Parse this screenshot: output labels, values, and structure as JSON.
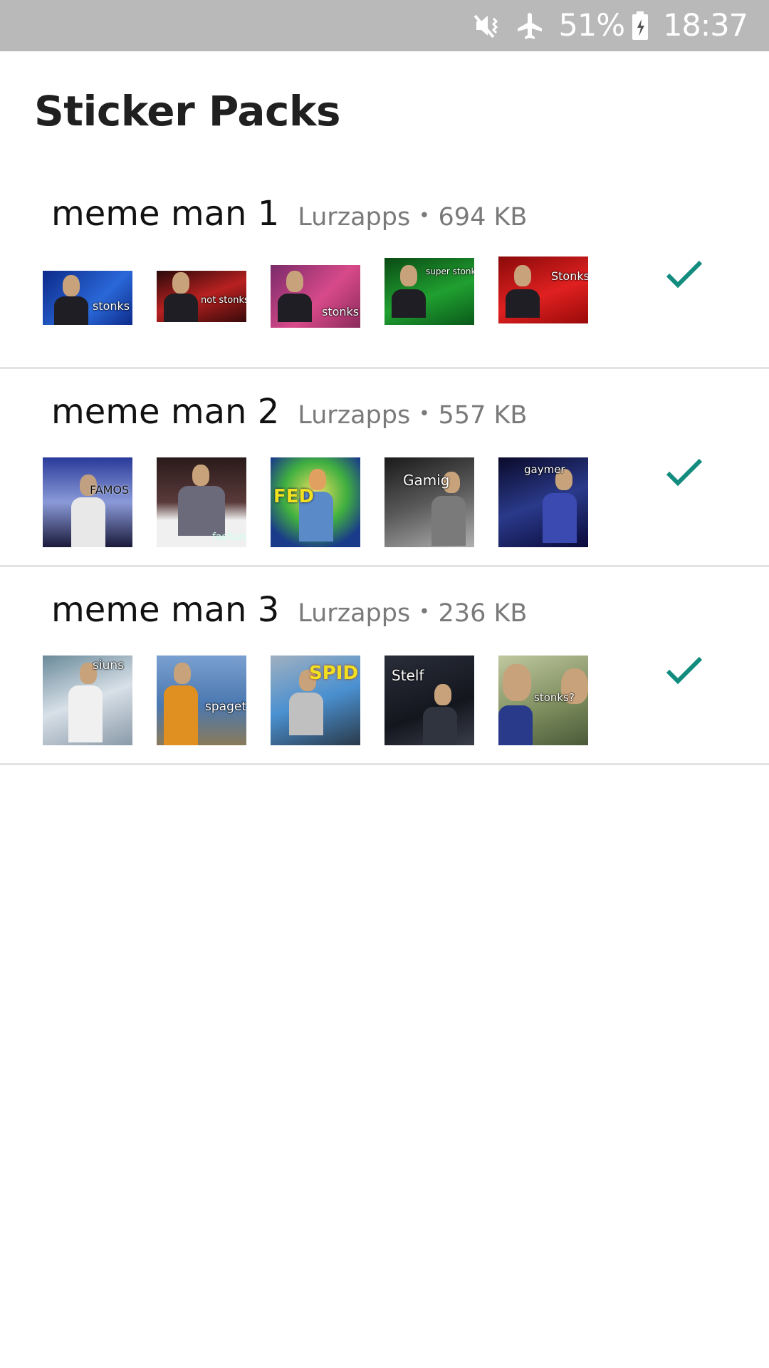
{
  "status_bar": {
    "icons": [
      "mute-vibrate-icon",
      "airplane-mode-icon",
      "battery-charging-icon"
    ],
    "battery": "51%",
    "time": "18:37",
    "background": "#b9b9b9"
  },
  "page": {
    "title": "Sticker Packs"
  },
  "accent_color": "#128c7e",
  "packs": [
    {
      "name": "meme man 1",
      "publisher": "Lurzapps",
      "separator": "•",
      "size": "694 KB",
      "added": true,
      "stickers": [
        {
          "caption": "stonks",
          "bg": "#1f4fb8"
        },
        {
          "caption": "not stonks",
          "bg": "#9a1c1c"
        },
        {
          "caption": "stonks",
          "bg": "#b83a78"
        },
        {
          "caption": "super stonks",
          "bg": "#1c8a2a"
        },
        {
          "caption": "Stonks",
          "bg": "#c81e1e"
        }
      ]
    },
    {
      "name": "meme man 2",
      "publisher": "Lurzapps",
      "separator": "•",
      "size": "557 KB",
      "added": true,
      "stickers": [
        {
          "caption": "FAMOS",
          "bg": "#4a5aa8"
        },
        {
          "caption": "fashun",
          "bg": "#6a4a3a"
        },
        {
          "caption": "FED",
          "bg": "#3aa84a"
        },
        {
          "caption": "Gamig",
          "bg": "#5a5a5a"
        },
        {
          "caption": "gaymer",
          "bg": "#1a2a6a"
        }
      ]
    },
    {
      "name": "meme man 3",
      "publisher": "Lurzapps",
      "separator": "•",
      "size": "236 KB",
      "added": true,
      "stickers": [
        {
          "caption": "siuns",
          "bg": "#9ab0c0"
        },
        {
          "caption": "spagett",
          "bg": "#4a6a9a"
        },
        {
          "caption": "SPID",
          "bg": "#3a7ab0"
        },
        {
          "caption": "Stelf",
          "bg": "#1e2230"
        },
        {
          "caption": "stonks?",
          "bg": "#9aa87a"
        }
      ]
    }
  ]
}
